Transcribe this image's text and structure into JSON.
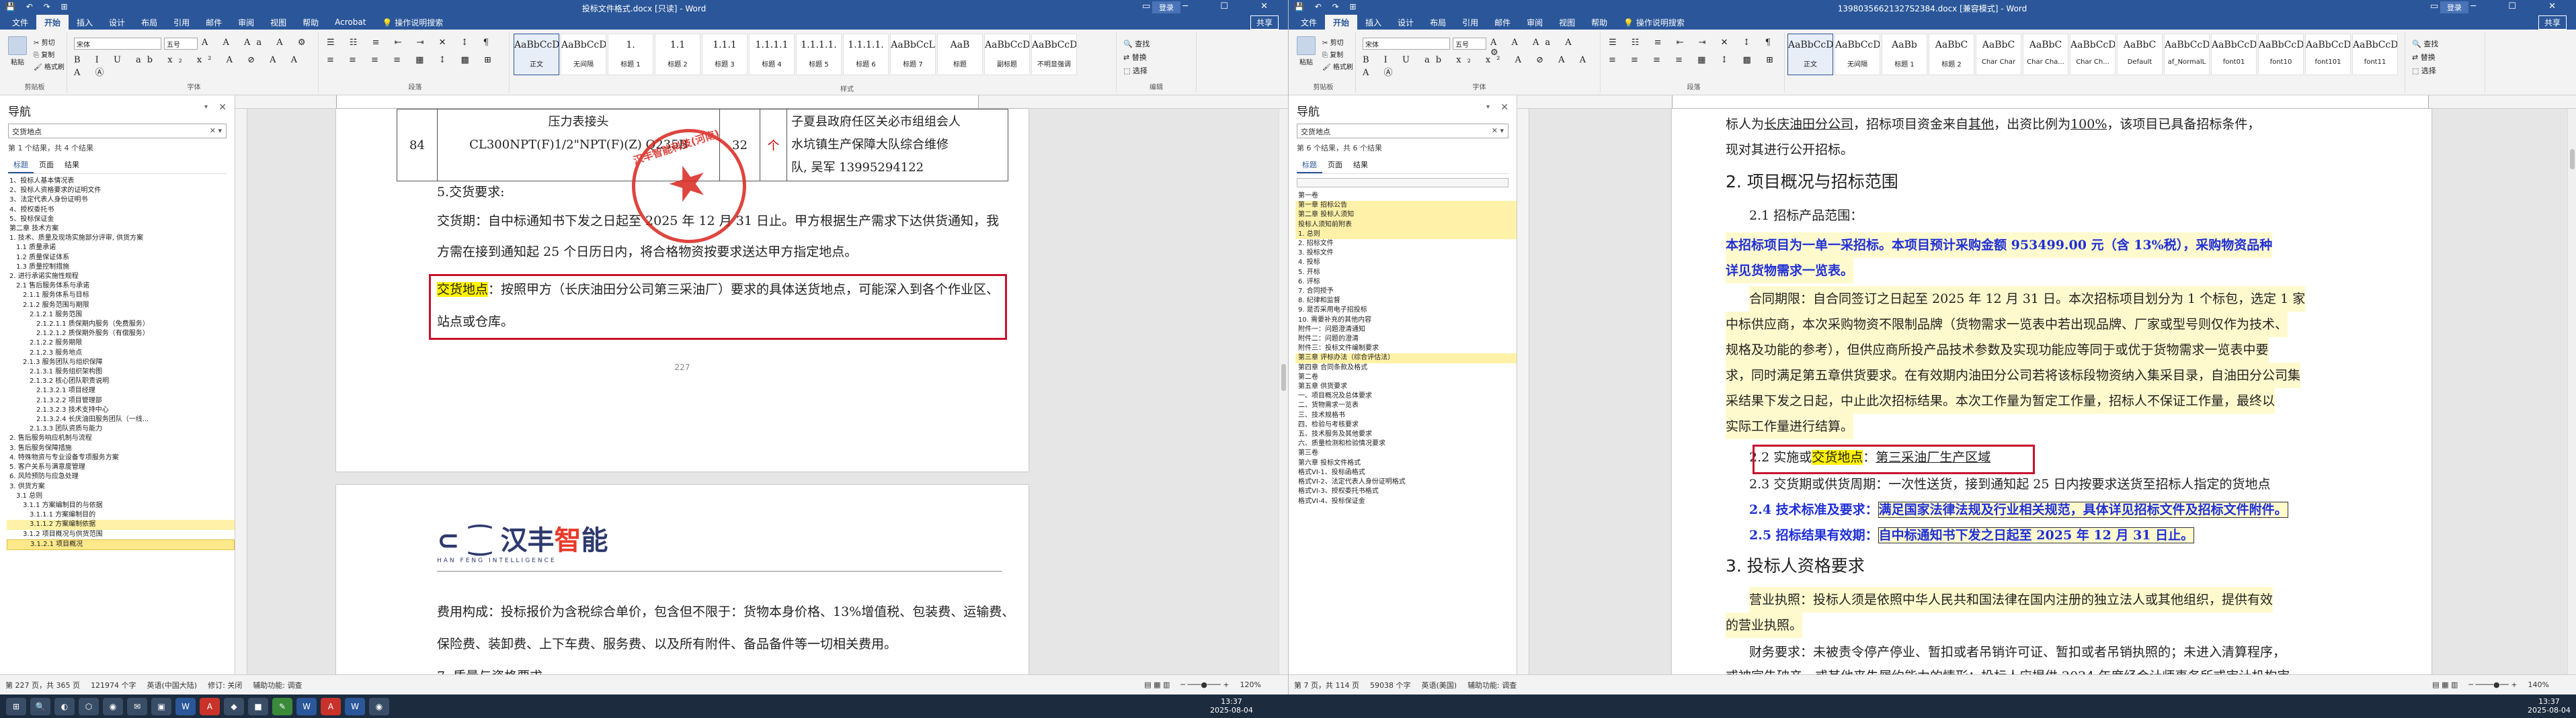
{
  "win1": {
    "title": "投标文件格式.docx [只读] - Word",
    "login": "登录",
    "menu": [
      "文件",
      "开始",
      "插入",
      "设计",
      "布局",
      "引用",
      "邮件",
      "审阅",
      "视图",
      "帮助",
      "Acrobat"
    ],
    "tell_me": "操作说明搜索",
    "share": "共享",
    "ribbon": {
      "paste": "粘贴",
      "cut": "剪切",
      "copy": "复制",
      "format_painter": "格式刷",
      "clipboard": "剪贴板",
      "font_name": "宋体",
      "font_size": "五号",
      "font_group": "字体",
      "para_group": "段落",
      "styles_group": "样式",
      "edit_group": "编辑",
      "find": "查找",
      "replace": "替换",
      "select": "选择",
      "styles": [
        {
          "preview": "AaBbCcDd",
          "name": "正文"
        },
        {
          "preview": "AaBbCcDd",
          "name": "无间隔"
        },
        {
          "preview": "1.",
          "name": "标题 1"
        },
        {
          "preview": "1.1",
          "name": "标题 2"
        },
        {
          "preview": "1.1.1",
          "name": "标题 3"
        },
        {
          "preview": "1.1.1.1",
          "name": "标题 4"
        },
        {
          "preview": "1.1.1.1.",
          "name": "标题 5"
        },
        {
          "preview": "1.1.1.1.",
          "name": "标题 6"
        },
        {
          "preview": "AaBbCcL",
          "name": "标题 7"
        },
        {
          "preview": "AaB",
          "name": "标题"
        },
        {
          "preview": "AaBbCcD",
          "name": "副标题"
        },
        {
          "preview": "AaBbCcDd",
          "name": "不明显强调"
        }
      ]
    },
    "nav": {
      "title": "导航",
      "search": "交货地点",
      "count": "第 1 个结果，共 4 个结果",
      "tabs": [
        "标题",
        "页面",
        "结果"
      ],
      "items": [
        {
          "t": "1、投标人基本情况表",
          "cls": ""
        },
        {
          "t": "2、投标人资格要求的证明文件",
          "cls": ""
        },
        {
          "t": "3、法定代表人身份证明书",
          "cls": ""
        },
        {
          "t": "4、授权委托书",
          "cls": ""
        },
        {
          "t": "5、投标保证金",
          "cls": ""
        },
        {
          "t": "第二章 技术方案",
          "cls": ""
        },
        {
          "t": "1. 技术、质量及现场实施部分评审, 供货方案",
          "cls": ""
        },
        {
          "t": "1.1 质量承诺",
          "cls": ""
        },
        {
          "t": "1.2 质量保证体系",
          "cls": ""
        },
        {
          "t": "1.3 质量控制措施",
          "cls": ""
        },
        {
          "t": "2. 进行承诺实施性规程",
          "cls": ""
        },
        {
          "t": "2.1 售后服务体系与承诺",
          "cls": ""
        },
        {
          "t": "2.1.1 服务体系与目标",
          "cls": ""
        },
        {
          "t": "2.1.2 服务范围与期限",
          "cls": ""
        },
        {
          "t": "2.1.2.1 服务范围",
          "cls": ""
        },
        {
          "t": "2.1.2.1.1 质保期内服务（免费服务）",
          "cls": ""
        },
        {
          "t": "2.1.2.1.2 质保期外服务（有偿服务）",
          "cls": ""
        },
        {
          "t": "2.1.2.2 服务期限",
          "cls": ""
        },
        {
          "t": "2.1.2.3 服务地点",
          "cls": ""
        },
        {
          "t": "2.1.3 服务团队与组织保障",
          "cls": ""
        },
        {
          "t": "2.1.3.1 服务组织架构图",
          "cls": ""
        },
        {
          "t": "2.1.3.2 核心团队职责说明",
          "cls": ""
        },
        {
          "t": "2.1.3.2.1 项目经理",
          "cls": ""
        },
        {
          "t": "2.1.3.2.2 项目管理部",
          "cls": ""
        },
        {
          "t": "2.1.3.2.3 技术支持中心",
          "cls": ""
        },
        {
          "t": "2.1.3.2.4 长庆油田服务团队（一线...",
          "cls": ""
        },
        {
          "t": "2.1.3.3 团队资质与能力",
          "cls": ""
        },
        {
          "t": "2. 售后服务响应机制与流程",
          "cls": ""
        },
        {
          "t": "3. 售后服务保障措施",
          "cls": ""
        },
        {
          "t": "4. 特殊物资与专业设备专项服务方案",
          "cls": ""
        },
        {
          "t": "5. 客户关系与满意度管理",
          "cls": ""
        },
        {
          "t": "6. 风险预防与应急处理",
          "cls": ""
        },
        {
          "t": "3. 供货方案",
          "cls": ""
        },
        {
          "t": "3.1 总则",
          "cls": ""
        },
        {
          "t": "3.1.1 方案编制目的与依据",
          "cls": ""
        },
        {
          "t": "3.1.1.1 方案编制目的",
          "cls": ""
        },
        {
          "t": "3.1.1.2 方案编制依据",
          "cls": "hl"
        },
        {
          "t": "3.1.2 项目概况与供货范围",
          "cls": ""
        },
        {
          "t": "3.1.2.1 项目概况",
          "cls": "cur"
        }
      ]
    },
    "doc": {
      "row_no": "84",
      "row_item": "压力表接头",
      "row_spec": "CL300NPT(F)1/2\"NPT(F)(Z) Q235B",
      "row_qty": "32",
      "row_unit": "个",
      "row_note1": "子夏县政府任区关必市组组会人",
      "row_note2": "水坑镇生产保障大队综合维修",
      "row_note3": "队, 吴军 13995294122",
      "req_title": "5.交货要求:",
      "p1a": "交货期：自中标通知书下发之日起至 2025 年 12 月 31 日止。甲方根据生产需求下达供货通知，我",
      "p1b": "方需在接到通知起 25 个日历日内，将合格物资按要求送达甲方指定地点。",
      "hl_word": "交货地点",
      "p2a": "：按照甲方（长庆油田分公司第三采油厂）要求的具体送货地点，可能深入到各个作业区、",
      "p2b": "站点或仓库。",
      "page_no": "227",
      "stamp_text": "汉丰智能科技(河南)",
      "logo_cn_a": "汉丰",
      "logo_cn_b": "智",
      "logo_cn_c": "能",
      "logo_en": "HAN FENG INTELLIGENCE",
      "p3a": "费用构成：投标报价为含税综合单价，包含但不限于：货物本身价格、13%增值税、包装费、运输费、",
      "p3b": "保险费、装卸费、上下车费、服务费、以及所有附件、备品备件等一切相关费用。",
      "p3c": "7. 质量与资格要求"
    },
    "status": {
      "page": "第 227 页，共 365 页",
      "words": "121974 个字",
      "lang": "英语(中国大陆)",
      "track": "修订: 关闭",
      "access": "辅助功能: 调查",
      "zoom": "120%"
    }
  },
  "win2": {
    "title": "13980356621327S2384.docx [兼容模式] - Word",
    "login": "登录",
    "menu": [
      "文件",
      "开始",
      "插入",
      "设计",
      "布局",
      "引用",
      "邮件",
      "审阅",
      "视图",
      "帮助"
    ],
    "tell_me": "操作说明搜索",
    "share": "共享",
    "ribbon": {
      "styles": [
        {
          "preview": "AaBbCcDd",
          "name": "正文"
        },
        {
          "preview": "AaBbCcDd",
          "name": "无间隔"
        },
        {
          "preview": "AaBb",
          "name": "标题 1"
        },
        {
          "preview": "AaBbC",
          "name": "标题 2"
        },
        {
          "preview": "AaBbC",
          "name": "Char Char"
        },
        {
          "preview": "AaBbC",
          "name": "Char Cha..."
        },
        {
          "preview": "AaBbCcD",
          "name": "Char Ch..."
        },
        {
          "preview": "AaBbC",
          "name": "Default"
        },
        {
          "preview": "AaBbCcD",
          "name": "af_NormalL"
        },
        {
          "preview": "AaBbCcD",
          "name": "font01"
        },
        {
          "preview": "AaBbCcD",
          "name": "font10"
        },
        {
          "preview": "AaBbCcD",
          "name": "font101"
        },
        {
          "preview": "AaBbCcD",
          "name": "font11"
        }
      ]
    },
    "nav": {
      "title": "导航",
      "search": "交货地点",
      "count": "第 6 个结果，共 6 个结果",
      "tabs": [
        "标题",
        "页面",
        "结果"
      ],
      "items": [
        {
          "t": "第一卷",
          "cls": ""
        },
        {
          "t": "第一章 招标公告",
          "cls": "hl"
        },
        {
          "t": "第二章 投标人须知",
          "cls": "hl"
        },
        {
          "t": "投标人须知前附表",
          "cls": "hl"
        },
        {
          "t": "1. 总则",
          "cls": "hl"
        },
        {
          "t": "2. 招标文件",
          "cls": ""
        },
        {
          "t": "3. 投标文件",
          "cls": ""
        },
        {
          "t": "4. 投标",
          "cls": ""
        },
        {
          "t": "5. 开标",
          "cls": ""
        },
        {
          "t": "6. 评标",
          "cls": ""
        },
        {
          "t": "7. 合同授予",
          "cls": ""
        },
        {
          "t": "8. 纪律和监督",
          "cls": ""
        },
        {
          "t": "9. 是否采用电子招投标",
          "cls": ""
        },
        {
          "t": "10. 需要补充的其他内容",
          "cls": ""
        },
        {
          "t": "附件一：问题澄清通知",
          "cls": ""
        },
        {
          "t": "附件二：问题的澄清",
          "cls": ""
        },
        {
          "t": "附件三：投标文件编制要求",
          "cls": ""
        },
        {
          "t": "第三章 评标办法（综合评估法）",
          "cls": "hl"
        },
        {
          "t": "第四章 合同条款及格式",
          "cls": ""
        },
        {
          "t": "第二卷",
          "cls": ""
        },
        {
          "t": "第五章 供货要求",
          "cls": ""
        },
        {
          "t": "一、项目概况及总体要求",
          "cls": ""
        },
        {
          "t": "二、货物需求一览表",
          "cls": ""
        },
        {
          "t": "三、技术规格书",
          "cls": ""
        },
        {
          "t": "四、检验与考核要求",
          "cls": ""
        },
        {
          "t": "五、技术服务及其他要求",
          "cls": ""
        },
        {
          "t": "六、质量检测和检验情况要求",
          "cls": ""
        },
        {
          "t": "第三卷",
          "cls": ""
        },
        {
          "t": "第六章 投标文件格式",
          "cls": ""
        },
        {
          "t": "格式VI-1、投标函格式",
          "cls": ""
        },
        {
          "t": "格式VI-2、法定代表人身份证明格式",
          "cls": ""
        },
        {
          "t": "格式VI-3、授权委托书格式",
          "cls": ""
        },
        {
          "t": "格式VI-4、投标保证金",
          "cls": ""
        }
      ]
    },
    "doc": {
      "l0a": "标人为",
      "l0b": "长庆油田分公司",
      "l0c": "，招标项目资金来自",
      "l0d": "其他",
      "l0e": "，出资比例为",
      "l0f": "100%",
      "l0g": "，该项目已具备招标条件，",
      "l1": "现对其进行公开招标。",
      "h2": "2. 项目概况与招标范围",
      "s21": "2.1 招标产品范围：",
      "b1": "本招标项目为一单一采招标。本项目预计采购金额 953499.00 元（含 13%税），采购物资品种",
      "b2": "详见货物需求一览表。",
      "c1": "合同期限：自合同签订之日起至 2025 年 12 月 31 日。本次招标项目划分为 1 个标包，选定 1 家",
      "c2": "中标供应商，本次采购物资不限制品牌（货物需求一览表中若出现品牌、厂家或型号则仅作为技术、",
      "c3": "规格及功能的参考），但供应商所投产品技术参数及实现功能应等同于或优于货物需求一览表中要",
      "c4": "求，同时满足第五章供货要求。在有效期内油田分公司若将该标段物资纳入集采目录，自油田分公司集",
      "c5": "采结果下发之日起，中止此次招标结果。本次工作量为暂定工作量，招标人不保证工作量，最终以",
      "c6": "实际工作量进行结算。",
      "s22a": "2.2 实施或",
      "s22hl": "交货地点",
      "s22b": "：",
      "s22c": "第三采油厂生产区域",
      "s23": "2.3 交货期或供货周期：一次性送货，接到通知起 25 日内按要求送货至招标人指定的货地点",
      "s24a": "2.4 技术标准及要求：",
      "s24b": "满足国家法律法规及行业相关规范，具体详见招标文件及招标文件附件。",
      "s25a": "2.5 招标结果有效期：",
      "s25b": "自中标通知书下发之日起至 2025 年 12 月 31 日止。",
      "h3": "3. 投标人资格要求",
      "q1": "营业执照：投标人须是依照中华人民共和国法律在国内注册的独立法人或其他组织，提供有效",
      "q2": "的营业执照。",
      "q3": "财务要求：未被责令停产停业、暂扣或者吊销许可证、暂扣或者吊销执照的；未进入清算程序，",
      "q4": "或被宣告破产，或其他丧失履约能力的情形；投标人应提供 2024 年度经会计师事务所或审计机构审"
    },
    "status": {
      "page": "第 7 页，共 114 页",
      "words": "59038 个字",
      "lang": "英语(美国)",
      "access": "辅助功能: 调查",
      "zoom": "140%"
    }
  },
  "taskbar": {
    "time1": "13:37",
    "date1": "2025-08-04",
    "time2": "13:37",
    "date2": "2025-08-04",
    "apps": [
      "⊞",
      "🔍",
      "◐",
      "⬡",
      "◉",
      "✉",
      "▣",
      "W",
      "A",
      "◆",
      "■",
      "✎",
      "W",
      "A",
      "W",
      "◉"
    ]
  }
}
